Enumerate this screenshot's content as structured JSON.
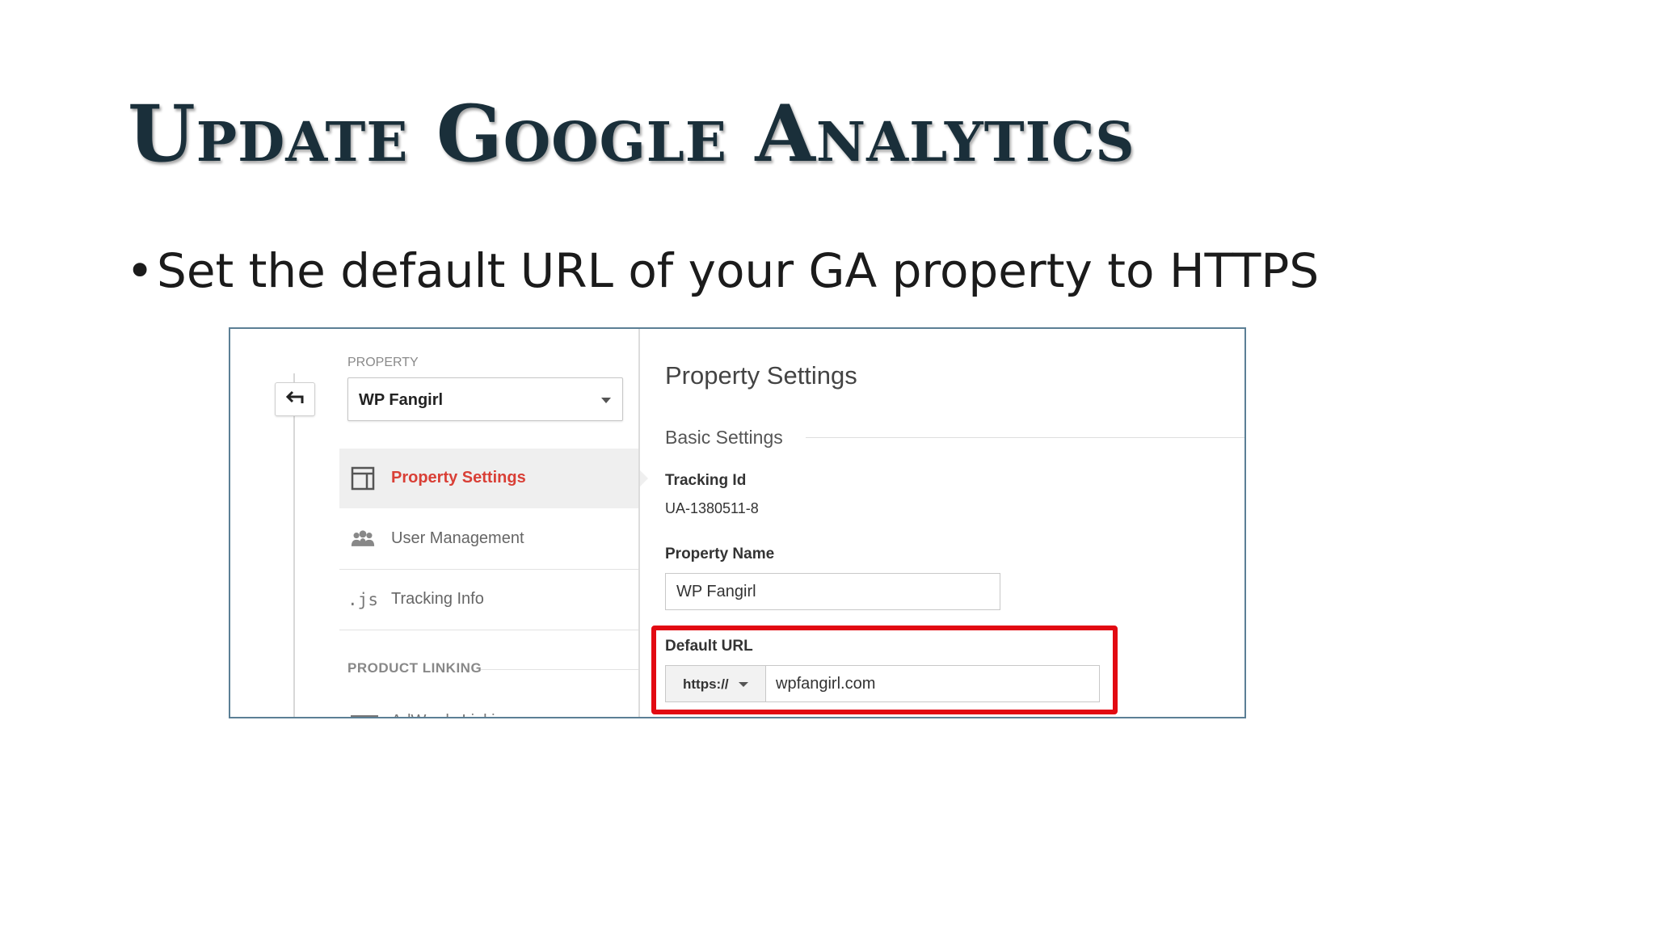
{
  "slide": {
    "title": "Update Google Analytics",
    "bullet": "Set the default URL of your GA property to HTTPS"
  },
  "screenshot": {
    "sidebar": {
      "property_label": "PROPERTY",
      "property_selected": "WP Fangirl",
      "items": [
        {
          "label": "Property Settings",
          "icon": "property-settings-icon",
          "active": true
        },
        {
          "label": "User Management",
          "icon": "users-icon",
          "active": false
        },
        {
          "label": "Tracking Info",
          "icon": "js-icon",
          "active": false
        }
      ],
      "section_label": "PRODUCT LINKING",
      "partial_item": "AdWords Linking"
    },
    "main": {
      "title": "Property Settings",
      "section": "Basic Settings",
      "tracking_id_label": "Tracking Id",
      "tracking_id_value": "UA-1380511-8",
      "property_name_label": "Property Name",
      "property_name_value": "WP Fangirl",
      "default_url_label": "Default URL",
      "scheme": "https://",
      "default_url_value": "wpfangirl.com"
    },
    "colors": {
      "highlight": "#e20a12",
      "active_nav": "#d93f36",
      "title": "#1a2f3a"
    }
  }
}
